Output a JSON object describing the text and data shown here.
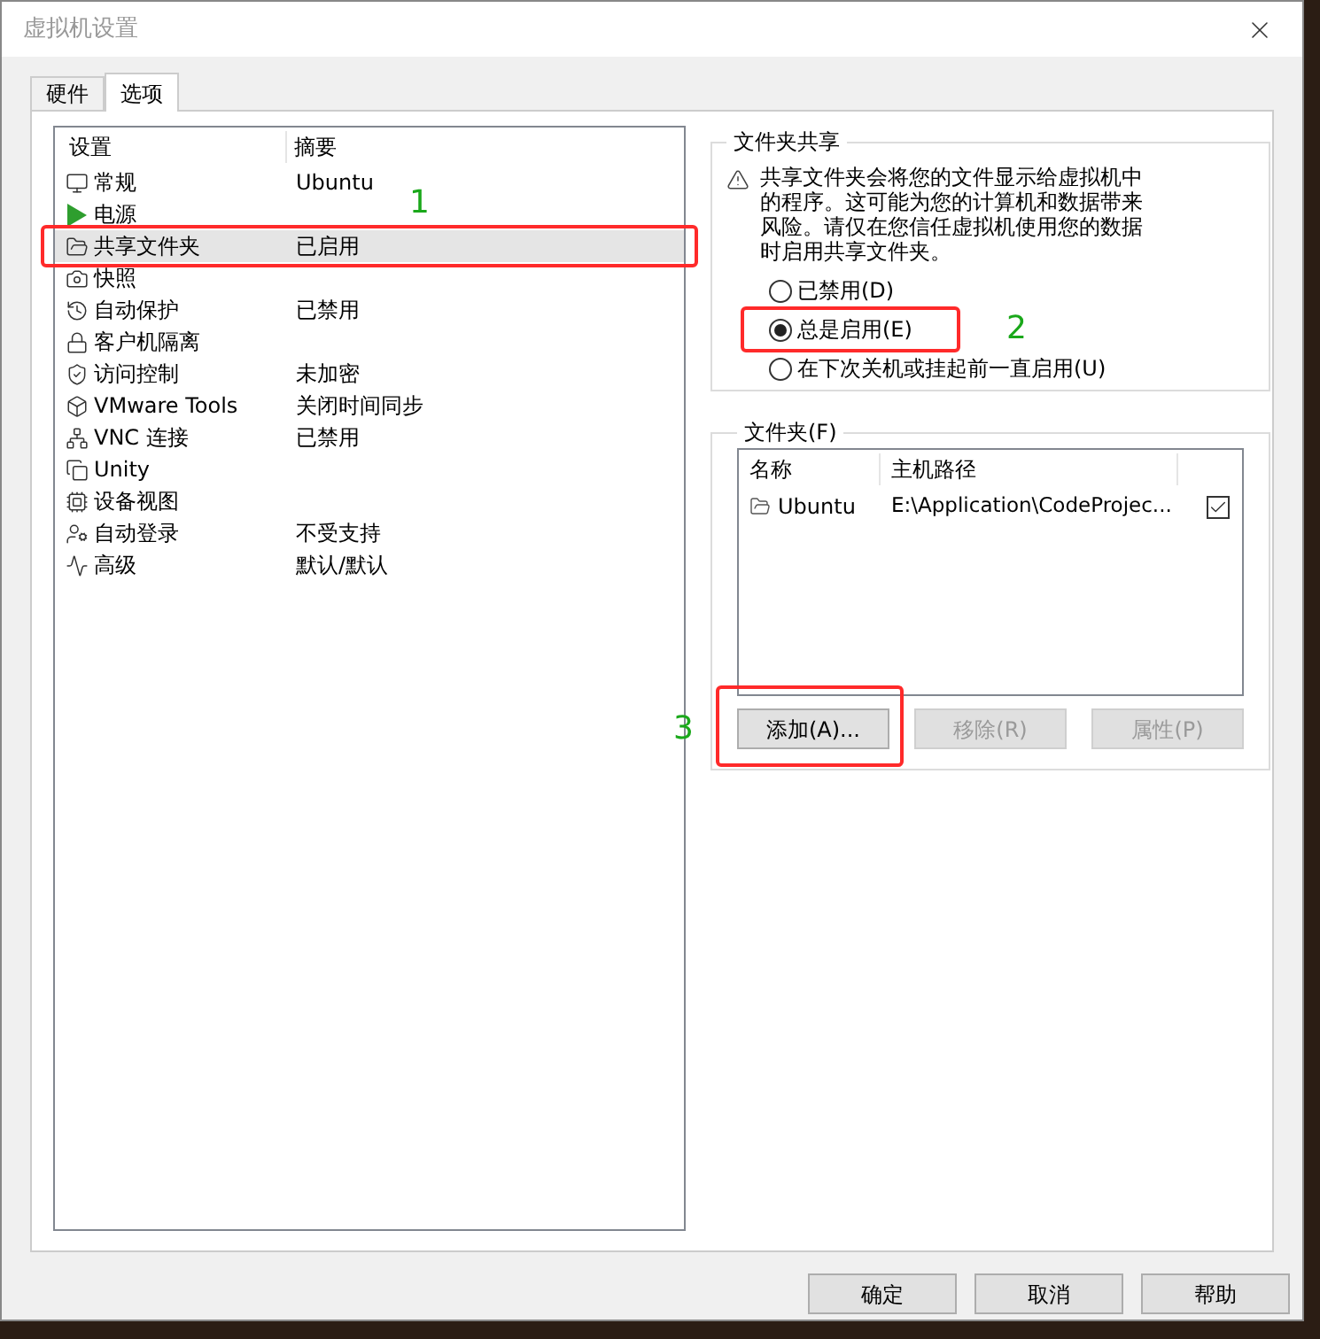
{
  "window": {
    "title": "虚拟机设置"
  },
  "tabs": [
    {
      "label": "硬件",
      "selected": false
    },
    {
      "label": "选项",
      "selected": true
    }
  ],
  "settings": {
    "columns": [
      "设置",
      "摘要"
    ],
    "rows": [
      {
        "name": "常规",
        "summary": "Ubuntu",
        "selected": false
      },
      {
        "name": "电源",
        "selected": false
      },
      {
        "name": "共享文件夹",
        "summary": "已启用",
        "selected": true
      },
      {
        "name": "快照",
        "selected": false
      },
      {
        "name": "自动保护",
        "summary": "已禁用",
        "selected": false
      },
      {
        "name": "客户机隔离",
        "selected": false
      },
      {
        "name": "访问控制",
        "summary": "未加密",
        "selected": false
      },
      {
        "name": "VMware Tools",
        "summary": "关闭时间同步",
        "selected": false
      },
      {
        "name": "VNC 连接",
        "summary": "已禁用",
        "selected": false
      },
      {
        "name": "Unity",
        "selected": false
      },
      {
        "name": "设备视图",
        "selected": false
      },
      {
        "name": "自动登录",
        "summary": "不受支持",
        "selected": false
      },
      {
        "name": "高级",
        "summary": "默认/默认",
        "selected": false
      }
    ]
  },
  "sharing": {
    "title": "文件夹共享",
    "warning": "共享文件夹会将您的文件显示给虚拟机中的程序。这可能为您的计算机和数据带来风险。请仅在您信任虚拟机使用您的数据时启用共享文件夹。",
    "options": [
      {
        "label": "已禁用(D)",
        "selected": false
      },
      {
        "label": "总是启用(E)",
        "selected": true
      },
      {
        "label": "在下次关机或挂起前一直启用(U)",
        "selected": false
      }
    ]
  },
  "folders": {
    "title": "文件夹(F)",
    "columns": [
      "名称",
      "主机路径"
    ],
    "rows": [
      {
        "name": "Ubuntu",
        "path": "E:\\Application\\CodeProjec...",
        "checked": true
      }
    ],
    "buttons": [
      {
        "label": "添加(A)...",
        "disabled": false
      },
      {
        "label": "移除(R)",
        "disabled": true
      },
      {
        "label": "属性(P)",
        "disabled": true
      }
    ]
  },
  "annotations": [
    "1",
    "2",
    "3"
  ],
  "buttons": [
    "确定",
    "取消",
    "帮助"
  ]
}
